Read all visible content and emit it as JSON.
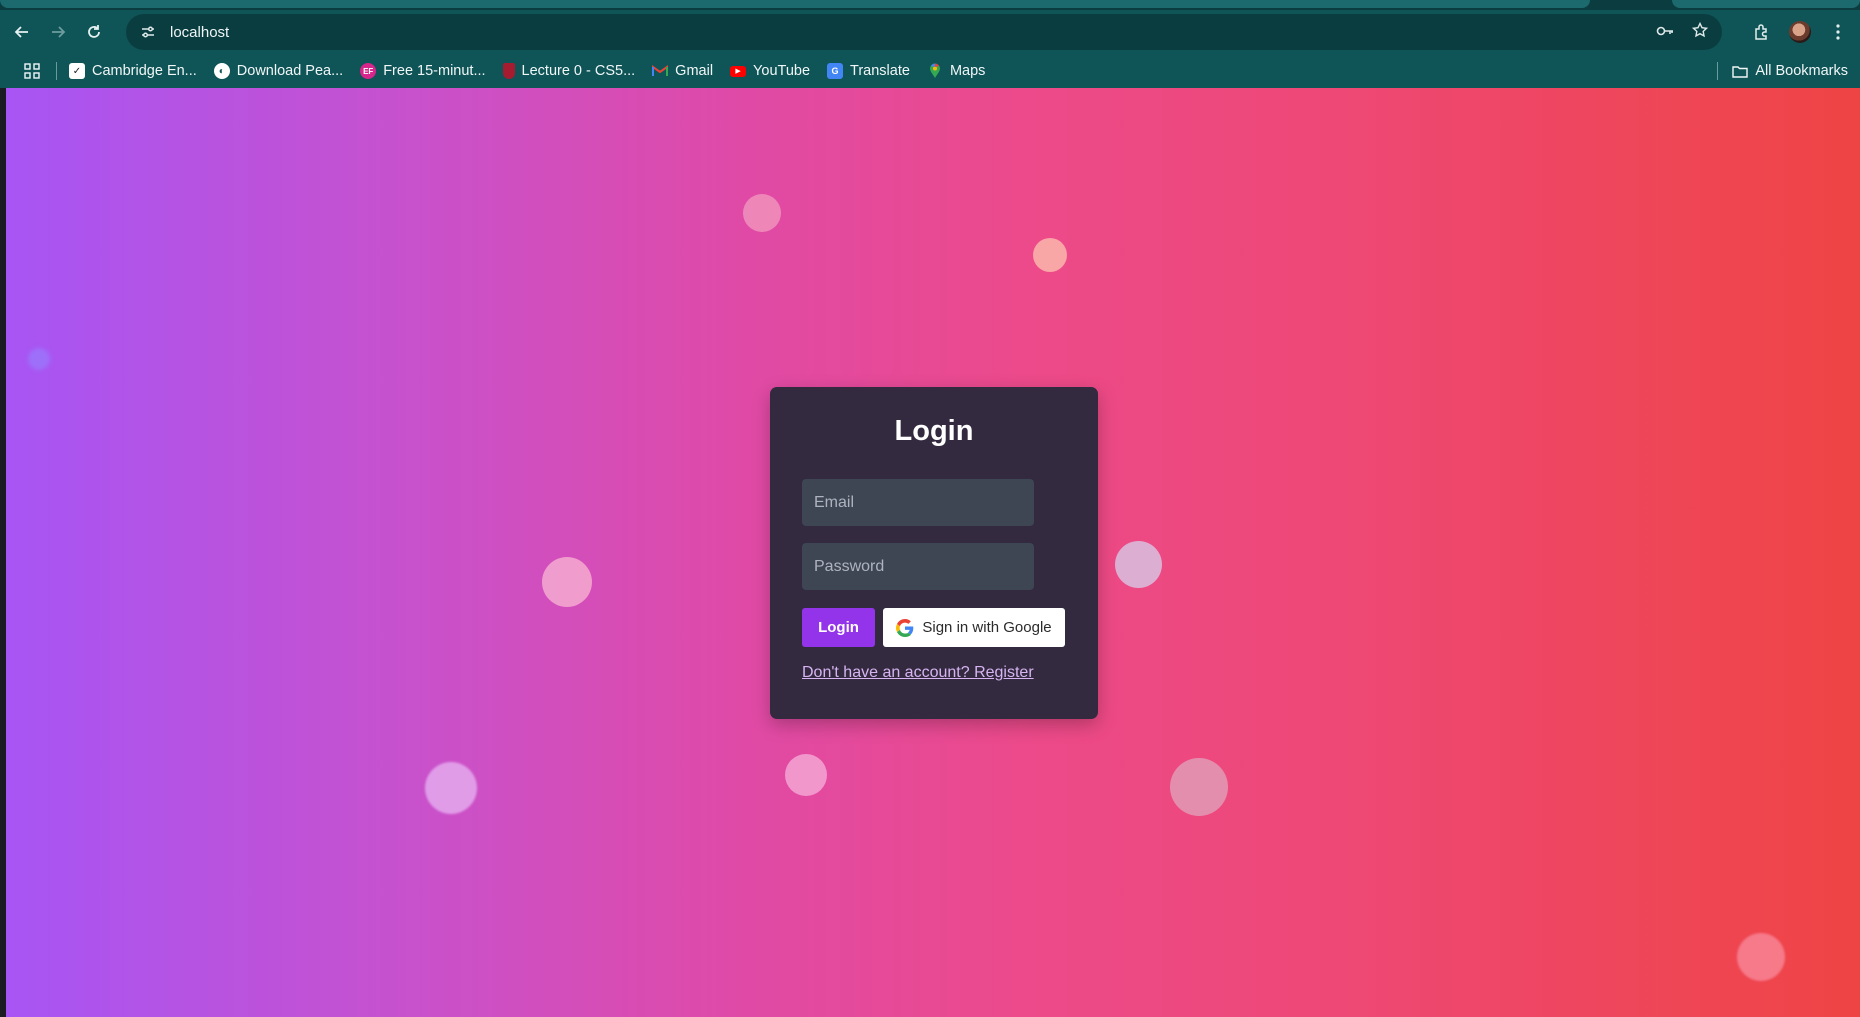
{
  "browser": {
    "url": "localhost",
    "bookmarks": [
      {
        "label": "Cambridge En...",
        "icon": "checkmark-icon"
      },
      {
        "label": "Download Pea...",
        "icon": "globe-icon"
      },
      {
        "label": "Free 15-minut...",
        "icon": "ef-icon"
      },
      {
        "label": "Lecture 0 - CS5...",
        "icon": "harvard-icon"
      },
      {
        "label": "Gmail",
        "icon": "gmail-icon"
      },
      {
        "label": "YouTube",
        "icon": "youtube-icon"
      },
      {
        "label": "Translate",
        "icon": "translate-icon"
      },
      {
        "label": "Maps",
        "icon": "maps-icon"
      }
    ],
    "all_bookmarks_label": "All Bookmarks"
  },
  "login": {
    "title": "Login",
    "email_placeholder": "Email",
    "password_placeholder": "Password",
    "login_button": "Login",
    "google_button": "Sign in with Google",
    "register_link": "Don't have an account? Register"
  },
  "colors": {
    "gradient_start": "#a755f5",
    "gradient_end": "#ef4444",
    "card_bg": "#332a3f",
    "field_bg": "#3e4553",
    "primary_button": "#9333ea",
    "link": "#d6b4f2"
  }
}
